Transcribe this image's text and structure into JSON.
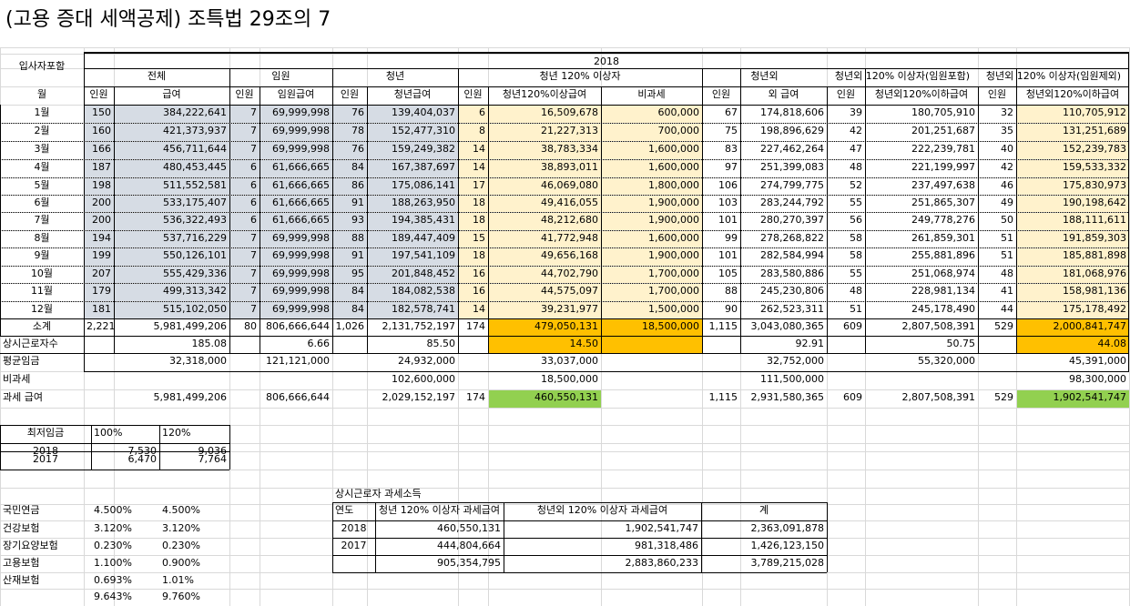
{
  "title": "(고용 증대 세액공제) 조특법 29조의 7",
  "colors": {
    "blue_fill": "#d6dce4",
    "peach_fill": "#fff2cc",
    "orange_fill": "#ffc000",
    "green_fill": "#92d050",
    "gridline": "#d9d9d9"
  },
  "table": {
    "corner_label": "입사자포함",
    "year": "2018",
    "groups": [
      "전체",
      "임원",
      "청년",
      "청년 120% 이상자",
      "청년외",
      "청년외 120% 이상자(임원포함)",
      "청년외 120% 이상자(임원제외)"
    ],
    "month_header": "월",
    "sub_headers": [
      "인원",
      "급여",
      "인원",
      "임원급여",
      "인원",
      "청년급여",
      "인원",
      "청년120%이상급여",
      "비과세",
      "인원",
      "외 급여",
      "인원",
      "청년외120%이하급여",
      "인원",
      "청년외120%이하급여"
    ],
    "rows": [
      [
        "1월",
        "150",
        "384,222,641",
        "7",
        "69,999,998",
        "76",
        "139,404,037",
        "6",
        "16,509,678",
        "600,000",
        "67",
        "174,818,606",
        "39",
        "180,705,910",
        "32",
        "110,705,912"
      ],
      [
        "2월",
        "160",
        "421,373,937",
        "7",
        "69,999,998",
        "78",
        "152,477,310",
        "8",
        "21,227,313",
        "700,000",
        "75",
        "198,896,629",
        "42",
        "201,251,687",
        "35",
        "131,251,689"
      ],
      [
        "3월",
        "166",
        "456,711,644",
        "7",
        "69,999,998",
        "76",
        "159,249,382",
        "14",
        "38,783,334",
        "1,600,000",
        "83",
        "227,462,264",
        "47",
        "222,239,781",
        "40",
        "152,239,783"
      ],
      [
        "4월",
        "187",
        "480,453,445",
        "6",
        "61,666,665",
        "84",
        "167,387,697",
        "14",
        "38,893,011",
        "1,600,000",
        "97",
        "251,399,083",
        "48",
        "221,199,997",
        "42",
        "159,533,332"
      ],
      [
        "5월",
        "198",
        "511,552,581",
        "6",
        "61,666,665",
        "86",
        "175,086,141",
        "17",
        "46,069,080",
        "1,800,000",
        "106",
        "274,799,775",
        "52",
        "237,497,638",
        "46",
        "175,830,973"
      ],
      [
        "6월",
        "200",
        "533,175,407",
        "6",
        "61,666,665",
        "91",
        "188,263,950",
        "18",
        "49,416,055",
        "1,900,000",
        "103",
        "283,244,792",
        "55",
        "251,865,307",
        "49",
        "190,198,642"
      ],
      [
        "7월",
        "200",
        "536,322,493",
        "6",
        "61,666,665",
        "93",
        "194,385,431",
        "18",
        "48,212,680",
        "1,900,000",
        "101",
        "280,270,397",
        "56",
        "249,778,276",
        "50",
        "188,111,611"
      ],
      [
        "8월",
        "194",
        "537,716,229",
        "7",
        "69,999,998",
        "88",
        "189,447,409",
        "15",
        "41,772,948",
        "1,600,000",
        "99",
        "278,268,822",
        "58",
        "261,859,301",
        "51",
        "191,859,303"
      ],
      [
        "9월",
        "199",
        "550,126,101",
        "7",
        "69,999,998",
        "91",
        "197,541,109",
        "18",
        "49,656,168",
        "1,900,000",
        "101",
        "282,584,994",
        "58",
        "255,881,896",
        "51",
        "185,881,898"
      ],
      [
        "10월",
        "207",
        "555,429,336",
        "7",
        "69,999,998",
        "95",
        "201,848,452",
        "16",
        "44,702,790",
        "1,700,000",
        "105",
        "283,580,886",
        "55",
        "251,068,974",
        "48",
        "181,068,976"
      ],
      [
        "11월",
        "179",
        "499,313,342",
        "7",
        "69,999,998",
        "84",
        "184,082,538",
        "16",
        "44,575,097",
        "1,700,000",
        "88",
        "245,230,806",
        "48",
        "228,981,134",
        "41",
        "158,981,136"
      ],
      [
        "12월",
        "181",
        "515,102,050",
        "7",
        "69,999,998",
        "84",
        "182,578,741",
        "14",
        "39,231,977",
        "1,500,000",
        "90",
        "262,523,311",
        "51",
        "245,178,490",
        "44",
        "175,178,492"
      ]
    ],
    "subtotal": [
      "소계",
      "2,221",
      "5,981,499,206",
      "80",
      "806,666,644",
      "1,026",
      "2,131,752,197",
      "174",
      "479,050,131",
      "18,500,000",
      "1,115",
      "3,043,080,365",
      "609",
      "2,807,508,391",
      "529",
      "2,000,841,747"
    ],
    "fte": [
      "상시근로자수",
      "",
      "185.08",
      "",
      "6.66",
      "",
      "85.50",
      "",
      "14.50",
      "",
      "",
      "92.91",
      "",
      "50.75",
      "",
      "44.08"
    ],
    "avg_wage": [
      "평균임금",
      "",
      "32,318,000",
      "",
      "121,121,000",
      "",
      "24,932,000",
      "",
      "33,037,000",
      "",
      "",
      "32,752,000",
      "",
      "55,320,000",
      "",
      "45,391,000"
    ],
    "nontax": [
      "비과세",
      "",
      "",
      "",
      "",
      "",
      "102,600,000",
      "",
      "18,500,000",
      "",
      "",
      "111,500,000",
      "",
      "",
      "",
      "98,300,000"
    ],
    "taxable": [
      "과세 급여",
      "",
      "5,981,499,206",
      "",
      "806,666,644",
      "",
      "2,029,152,197",
      "174",
      "460,550,131",
      "",
      "1,115",
      "2,931,580,365",
      "609",
      "2,807,508,391",
      "529",
      "1,902,541,747"
    ]
  },
  "min_wage": {
    "header": [
      "최저임금",
      "100%",
      "120%"
    ],
    "rows": [
      [
        "2018",
        "7,530",
        "9,036"
      ],
      [
        "2017",
        "6,470",
        "7,764"
      ]
    ]
  },
  "insurance": {
    "rows": [
      [
        "국민연금",
        "4.500%",
        "4.500%"
      ],
      [
        "건강보험",
        "3.120%",
        "3.120%"
      ],
      [
        "장기요양보험",
        "0.230%",
        "0.230%"
      ],
      [
        "고용보험",
        "1.100%",
        "0.900%"
      ],
      [
        "산재보험",
        "0.693%",
        "1.01%"
      ],
      [
        "",
        "9.643%",
        "9.760%"
      ]
    ]
  },
  "income": {
    "title": "상시근로자 과세소득",
    "header": [
      "연도",
      "청년 120% 이상자 과세급여",
      "청년외 120% 이상자 과세급여",
      "계"
    ],
    "rows": [
      [
        "2018",
        "460,550,131",
        "1,902,541,747",
        "2,363,091,878"
      ],
      [
        "2017",
        "444,804,664",
        "981,318,486",
        "1,426,123,150"
      ],
      [
        "",
        "905,354,795",
        "2,883,860,233",
        "3,789,215,028"
      ]
    ]
  }
}
